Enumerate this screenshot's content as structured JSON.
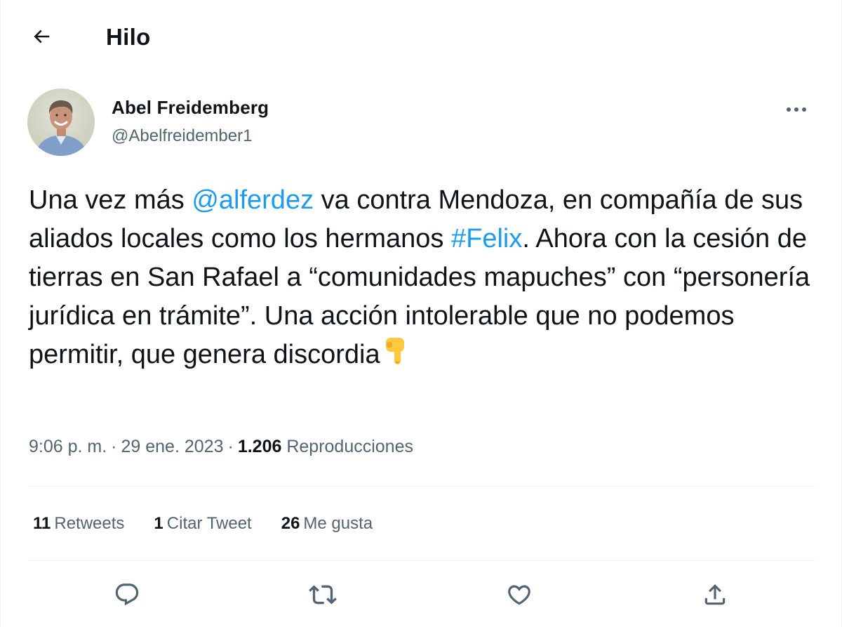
{
  "header": {
    "title": "Hilo",
    "back_icon": "arrow-left-icon"
  },
  "author": {
    "name": "Abel Freidemberg",
    "handle": "@Abelfreidember1",
    "more_icon": "more-icon"
  },
  "tweet": {
    "segments": [
      "Una vez más ",
      "@alferdez",
      " va contra Mendoza, en compañía de sus aliados locales como los hermanos ",
      "#Felix",
      ". Ahora con la cesión de tierras en San Rafael a “comunidades mapuches” con “personería jurídica en trámite”. Una acción intolerable que no podemos permitir, que genera discordia"
    ],
    "emoji": "backhand-index-pointing-down-emoji"
  },
  "meta": {
    "time": "9:06 p. m.",
    "separator": "·",
    "date": "29 ene. 2023",
    "views_count": "1.206",
    "views_label": "Reproducciones"
  },
  "stats": {
    "retweets_count": "11",
    "retweets_label": "Retweets",
    "quotes_count": "1",
    "quotes_label": "Citar Tweet",
    "likes_count": "26",
    "likes_label": "Me gusta"
  },
  "actions": [
    "reply-icon",
    "retweet-icon",
    "like-icon",
    "share-icon"
  ],
  "colors": {
    "link": "#1d9bf0",
    "text": "#0f1419",
    "secondary": "#536471",
    "divider": "#eff3f4"
  }
}
